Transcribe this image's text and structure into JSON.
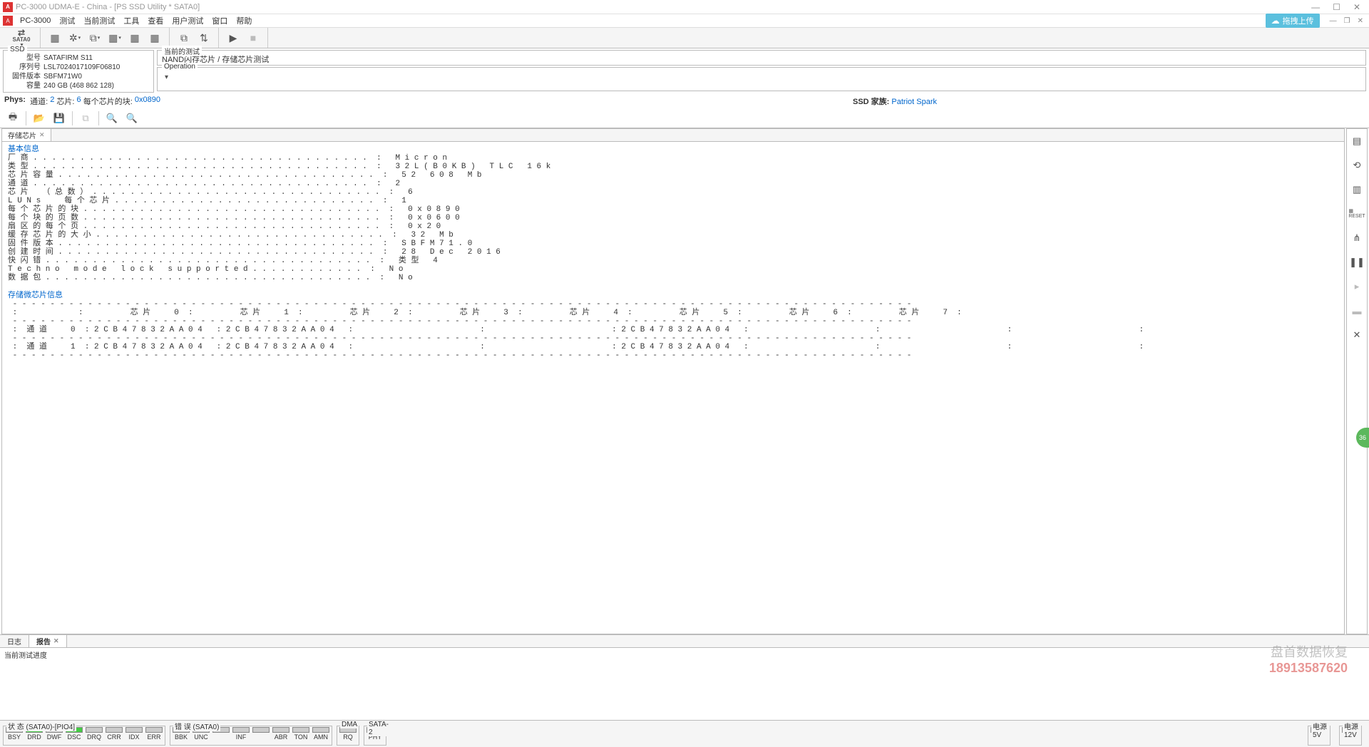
{
  "titlebar": {
    "title": "PC-3000 UDMA-E - China - [PS SSD Utility * SATA0]"
  },
  "menubar": {
    "app": "PC-3000",
    "items": [
      "测试",
      "当前测试",
      "工具",
      "查看",
      "用户测试",
      "窗口",
      "帮助"
    ],
    "upload": "拖拽上传"
  },
  "ssd_panel": {
    "title": "SSD",
    "rows": [
      {
        "label": "型号",
        "value": "SATAFIRM   S11"
      },
      {
        "label": "序列号",
        "value": "LSL7024017109F06810"
      },
      {
        "label": "固件版本",
        "value": "SBFM71W0"
      },
      {
        "label": "容量",
        "value": "240 GB (468 862 128)"
      }
    ]
  },
  "test_panel": {
    "title": "当前的测试",
    "value": "NAND闪存芯片 / 存储芯片测试"
  },
  "op_panel": {
    "title": "Operation",
    "dd": "▾"
  },
  "phys": {
    "label": "Phys:",
    "ch_lbl": "通道:",
    "ch_val": "2",
    "chip_lbl": "芯片:",
    "chip_val": "6",
    "blk_lbl": "每个芯片的块:",
    "blk_val": "0x0890",
    "fam_lbl": "SSD 家族:",
    "fam_val": "Patriot Spark"
  },
  "main_tab": {
    "label": "存储芯片"
  },
  "basic_info": {
    "header": "基本信息",
    "lines": [
      {
        "k": "厂商",
        "v": "Micron"
      },
      {
        "k": "类型",
        "v": "32L(B0KB) TLC 16k"
      },
      {
        "k": "芯片容量",
        "v": "52 608 Mb"
      },
      {
        "k": "通道",
        "v": "2"
      },
      {
        "k": "芯片 （总数）",
        "v": "6"
      },
      {
        "k": "LUNs  每个芯片",
        "v": "1"
      },
      {
        "k": "每个芯片的块",
        "v": "0x0890"
      },
      {
        "k": "每个块的页数",
        "v": "0x0600"
      },
      {
        "k": "扇区的每个页",
        "v": "0x20"
      },
      {
        "k": "缓存芯片的大小",
        "v": "32 Mb"
      },
      {
        "k": "固件版本",
        "v": "SBFM71.0"
      },
      {
        "k": "创建时间",
        "v": "28 Dec 2016"
      },
      {
        "k": "快闪错",
        "v": "类型 4"
      },
      {
        "k": "Techno mode lock supported",
        "v": "No"
      },
      {
        "k": "数据包",
        "v": "No"
      }
    ]
  },
  "storage_info": {
    "header": "存储微芯片信息",
    "chip_hdr": "芯片",
    "ch_lbl": "通道",
    "chip_count": 8,
    "rows": [
      {
        "ch": "0",
        "cells": [
          "2CB47832AA04",
          "2CB47832AA04",
          "",
          "",
          "2CB47832AA04",
          "",
          "",
          ""
        ]
      },
      {
        "ch": "1",
        "cells": [
          "2CB47832AA04",
          "2CB47832AA04",
          "",
          "",
          "2CB47832AA04",
          "",
          "",
          ""
        ]
      }
    ]
  },
  "bottom_tabs": {
    "log": "日志",
    "report": "报告"
  },
  "progress_lbl": "当前测试进度",
  "status": {
    "state": {
      "title": "状 态 (SATA0)-[PIO4]",
      "leds": [
        {
          "lbl": "BSY",
          "on": false
        },
        {
          "lbl": "DRD",
          "on": true
        },
        {
          "lbl": "DWF",
          "on": false
        },
        {
          "lbl": "DSC",
          "on": true
        },
        {
          "lbl": "DRQ",
          "on": false
        },
        {
          "lbl": "CRR",
          "on": false
        },
        {
          "lbl": "IDX",
          "on": false
        },
        {
          "lbl": "ERR",
          "on": false
        }
      ]
    },
    "error": {
      "title": "错 误 (SATA0)",
      "leds": [
        {
          "lbl": "BBK",
          "on": false
        },
        {
          "lbl": "UNC",
          "on": false
        },
        {
          "lbl": "",
          "on": false
        },
        {
          "lbl": "INF",
          "on": false
        },
        {
          "lbl": "",
          "on": false
        },
        {
          "lbl": "ABR",
          "on": false
        },
        {
          "lbl": "TON",
          "on": false
        },
        {
          "lbl": "AMN",
          "on": false
        }
      ]
    },
    "dma": {
      "title": "DMA",
      "leds": [
        {
          "lbl": "RQ",
          "on": false
        }
      ]
    },
    "sata2": {
      "title": "SATA-2",
      "leds": [
        {
          "lbl": "PHY",
          "on": true
        }
      ]
    },
    "p5v": {
      "title": "电源 5V",
      "leds": [
        {
          "lbl": "5V",
          "on": true
        }
      ]
    },
    "p12v": {
      "title": "电源 12V",
      "leds": [
        {
          "lbl": "12V",
          "on": true
        }
      ]
    }
  },
  "watermark": {
    "text": "盘首数据恢复",
    "phone": "18913587620"
  }
}
